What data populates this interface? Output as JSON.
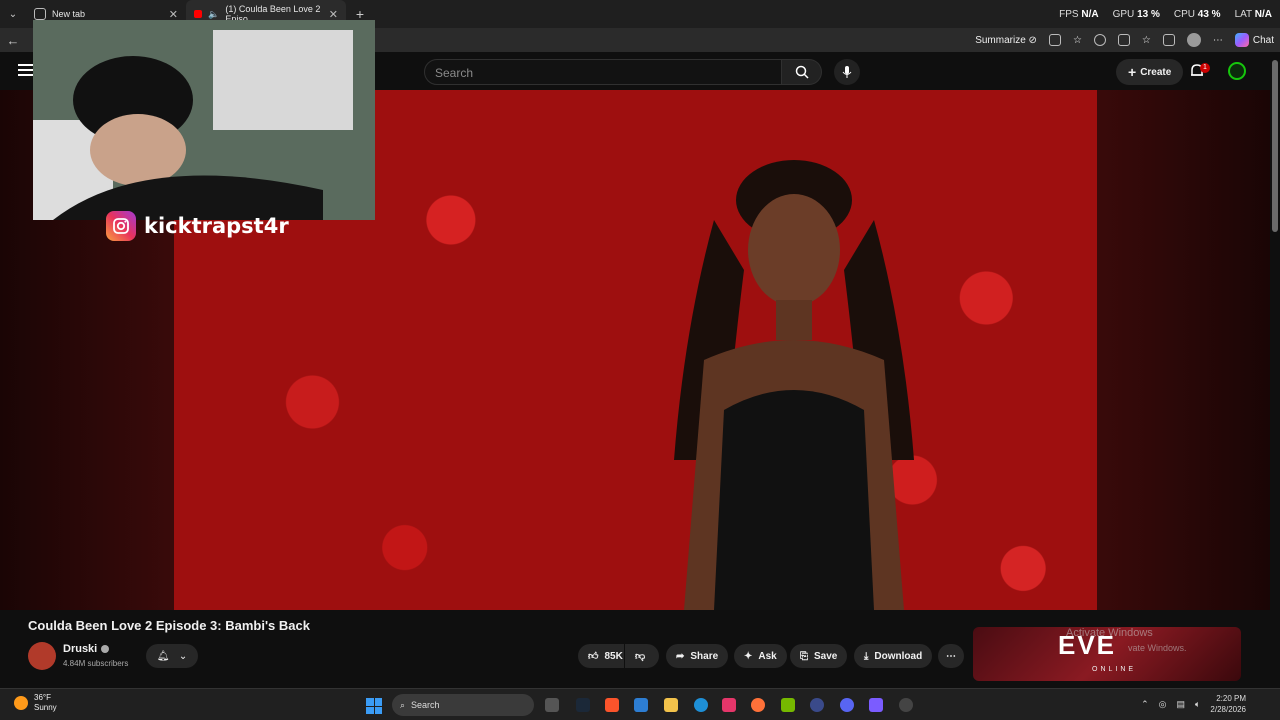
{
  "browser": {
    "tabs": [
      {
        "label": "New tab"
      },
      {
        "label": "(1) Coulda Been Love 2 Episo"
      }
    ],
    "new_tab": "+",
    "perf": {
      "fps_label": "FPS",
      "fps": "N/A",
      "gpu_label": "GPU",
      "gpu": "13 %",
      "cpu_label": "CPU",
      "cpu": "43 %",
      "lat_label": "LAT",
      "lat": "N/A"
    },
    "summarize": "Summarize",
    "chat": "Chat"
  },
  "youtube": {
    "search_placeholder": "Search",
    "create_label": "Create",
    "notif_count": "1"
  },
  "overlay": {
    "instagram_handle": "kicktrapst4r"
  },
  "video": {
    "title": "Coulda Been Love 2 Episode 3: Bambi's Back",
    "channel": "Druski",
    "subscribers": "4.84M subscribers",
    "likes": "85K",
    "share": "Share",
    "ask": "Ask",
    "save": "Save",
    "download": "Download"
  },
  "ad": {
    "brand": "EVE",
    "tagline": "ONLINE",
    "activate_title": "Activate Windows",
    "activate_sub": "vate Windows."
  },
  "taskbar": {
    "temp": "36°F",
    "condition": "Sunny",
    "search": "Search",
    "time": "2:20 PM",
    "date": "2/28/2026"
  },
  "colors": {
    "accent_red": "#cc0000",
    "bg": "#0f0f0f",
    "win_blue": "#3b9cf5"
  }
}
